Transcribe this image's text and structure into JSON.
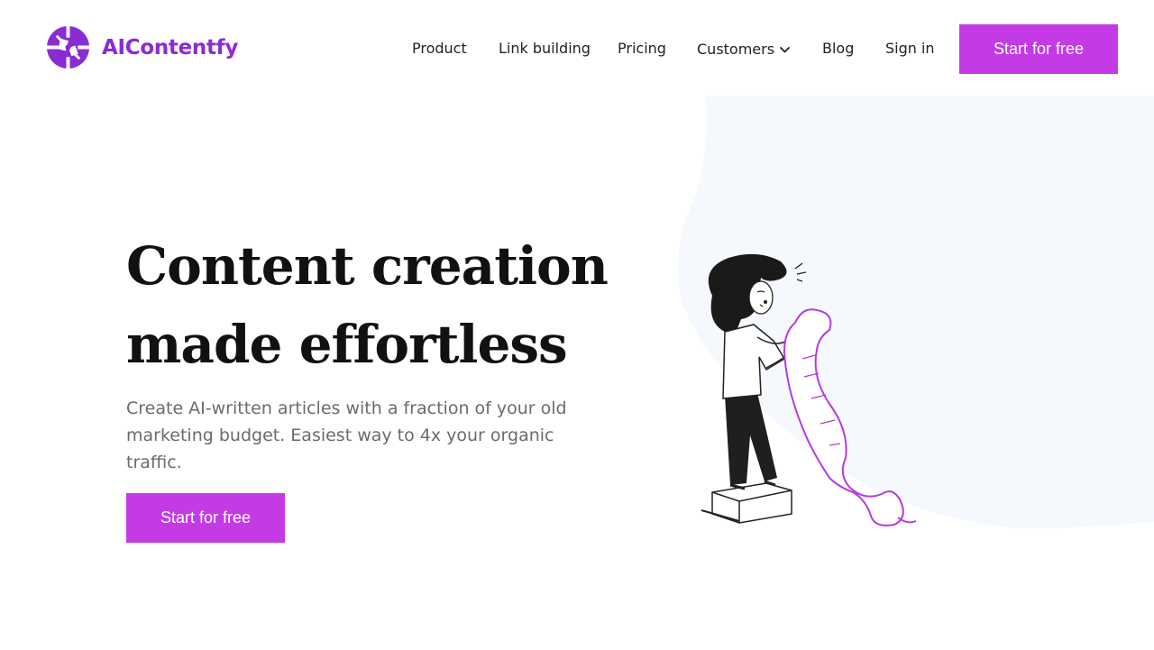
{
  "brand": {
    "name": "AIContentfy",
    "color": "#8a2bd6",
    "logo_icon": "aicontentfy-logo-icon"
  },
  "nav": {
    "items": [
      {
        "label": "Product"
      },
      {
        "label": "Link building"
      },
      {
        "label": "Pricing"
      },
      {
        "label": "Customers",
        "has_dropdown": true,
        "icon": "chevron-down-icon"
      },
      {
        "label": "Blog"
      },
      {
        "label": "Sign in"
      }
    ],
    "cta_label": "Start for free"
  },
  "hero": {
    "headline_line1": "Content creation",
    "headline_line2": "made effortless",
    "subtext": "Create AI-written articles with a fraction of your old marketing budget. Easiest way to 4x your organic traffic.",
    "cta_label": "Start for free",
    "illustration": "woman-reading-long-scroll-illustration"
  },
  "colors": {
    "accent": "#c43be6",
    "hero_bg": "#f5f8fc",
    "text_dark": "#111111",
    "text_muted": "#6b6b6b"
  }
}
